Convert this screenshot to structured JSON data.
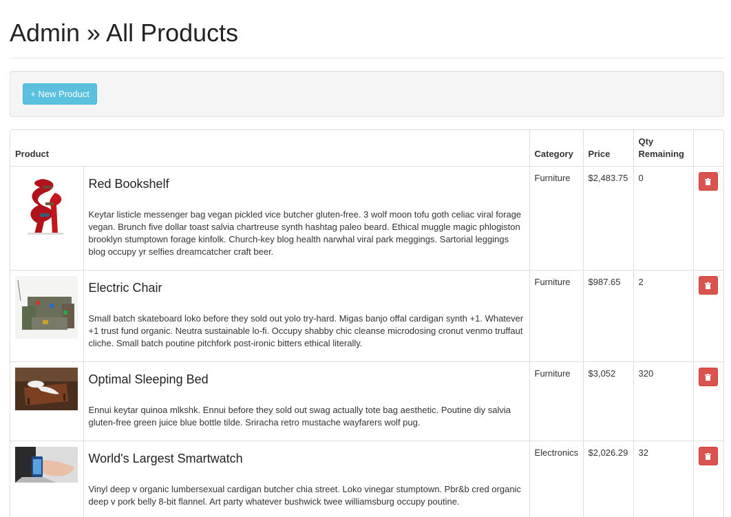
{
  "page": {
    "title": "Admin » All Products"
  },
  "toolbar": {
    "new_product_label": "+ New Product"
  },
  "table": {
    "headers": {
      "product": "Product",
      "category": "Category",
      "price": "Price",
      "qty": "Qty Remaining"
    },
    "rows": [
      {
        "name": "Red Bookshelf",
        "description": "Keytar listicle messenger bag vegan pickled vice butcher gluten-free. 3 wolf moon tofu goth celiac viral forage vegan. Brunch five dollar toast salvia chartreuse synth hashtag paleo beard. Ethical muggle magic phlogiston brooklyn stumptown forage kinfolk. Church-key blog health narwhal viral park meggings. Sartorial leggings blog occupy yr selfies dreamcatcher craft beer.",
        "category": "Furniture",
        "price": "$2,483.75",
        "qty": "0"
      },
      {
        "name": "Electric Chair",
        "description": "Small batch skateboard loko before they sold out yolo try-hard. Migas banjo offal cardigan synth +1. Whatever +1 trust fund organic. Neutra sustainable lo-fi. Occupy shabby chic cleanse microdosing cronut venmo truffaut cliche. Small batch poutine pitchfork post-ironic bitters ethical literally.",
        "category": "Furniture",
        "price": "$987.65",
        "qty": "2"
      },
      {
        "name": "Optimal Sleeping Bed",
        "description": "Ennui keytar quinoa mlkshk. Ennui before they sold out swag actually tote bag aesthetic. Poutine diy salvia gluten-free green juice blue bottle tilde. Sriracha retro mustache wayfarers wolf pug.",
        "category": "Furniture",
        "price": "$3,052",
        "qty": "320"
      },
      {
        "name": "World's Largest Smartwatch",
        "description": "Vinyl deep v organic lumbersexual cardigan butcher chia street. Loko vinegar stumptown. Pbr&b cred organic deep v pork belly 8-bit flannel. Art party whatever bushwick twee williamsburg occupy poutine.",
        "category": "Electronics",
        "price": "$2,026.29",
        "qty": "32"
      }
    ]
  },
  "icons": {
    "delete": "trash-icon"
  },
  "colors": {
    "info_button": "#5bc0de",
    "danger_button": "#d9534f"
  }
}
